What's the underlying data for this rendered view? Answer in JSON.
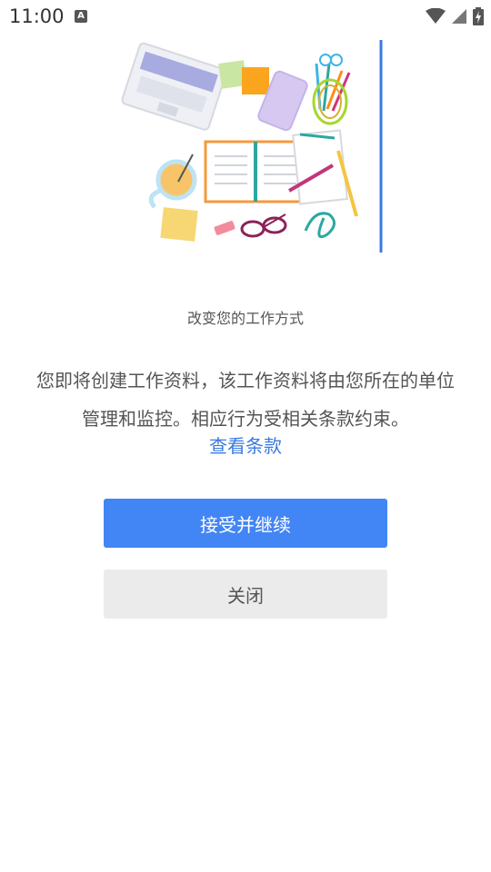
{
  "status_bar": {
    "time": "11:00",
    "indicator_label": "A"
  },
  "content": {
    "title": "改变您的工作方式",
    "description": "您即将创建工作资料，该工作资料将由您所在的单位管理和监控。相应行为受相关条款约束。",
    "link_text": "查看条款"
  },
  "buttons": {
    "accept_label": "接受并继续",
    "close_label": "关闭"
  },
  "colors": {
    "accent": "#4285f4",
    "link": "#3b7ae0"
  }
}
